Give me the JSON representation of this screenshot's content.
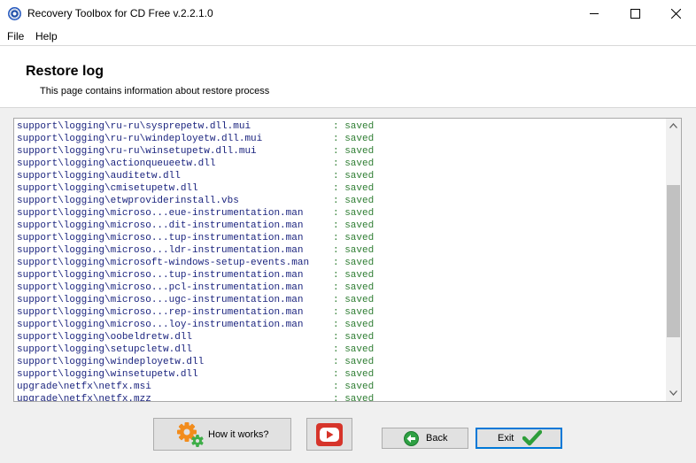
{
  "window": {
    "title": "Recovery Toolbox for CD Free v.2.2.1.0",
    "controls": [
      "minimize-icon",
      "maximize-icon",
      "close-icon"
    ]
  },
  "menu": {
    "file": "File",
    "help": "Help"
  },
  "page": {
    "title": "Restore log",
    "subtitle": "This page contains information about restore process"
  },
  "log": {
    "separator": ":",
    "rows": [
      {
        "path": "support\\logging\\ru-ru\\sysprepetw.dll.mui",
        "status": ": saved"
      },
      {
        "path": "support\\logging\\ru-ru\\windeployetw.dll.mui",
        "status": ": saved"
      },
      {
        "path": "support\\logging\\ru-ru\\winsetupetw.dll.mui",
        "status": ": saved"
      },
      {
        "path": "support\\logging\\actionqueueetw.dll",
        "status": ": saved"
      },
      {
        "path": "support\\logging\\auditetw.dll",
        "status": ": saved"
      },
      {
        "path": "support\\logging\\cmisetupetw.dll",
        "status": ": saved"
      },
      {
        "path": "support\\logging\\etwproviderinstall.vbs",
        "status": ": saved"
      },
      {
        "path": "support\\logging\\microso...eue-instrumentation.man",
        "status": ": saved"
      },
      {
        "path": "support\\logging\\microso...dit-instrumentation.man",
        "status": ": saved"
      },
      {
        "path": "support\\logging\\microso...tup-instrumentation.man",
        "status": ": saved"
      },
      {
        "path": "support\\logging\\microso...ldr-instrumentation.man",
        "status": ": saved"
      },
      {
        "path": "support\\logging\\microsoft-windows-setup-events.man",
        "status": ": saved"
      },
      {
        "path": "support\\logging\\microso...tup-instrumentation.man",
        "status": ": saved"
      },
      {
        "path": "support\\logging\\microso...pcl-instrumentation.man",
        "status": ": saved"
      },
      {
        "path": "support\\logging\\microso...ugc-instrumentation.man",
        "status": ": saved"
      },
      {
        "path": "support\\logging\\microso...rep-instrumentation.man",
        "status": ": saved"
      },
      {
        "path": "support\\logging\\microso...loy-instrumentation.man",
        "status": ": saved"
      },
      {
        "path": "support\\logging\\oobeldretw.dll",
        "status": ": saved"
      },
      {
        "path": "support\\logging\\setupcletw.dll",
        "status": ": saved"
      },
      {
        "path": "support\\logging\\windeployetw.dll",
        "status": ": saved"
      },
      {
        "path": "support\\logging\\winsetupetw.dll",
        "status": ": saved"
      },
      {
        "path": "upgrade\\netfx\\netfx.msi",
        "status": ": saved"
      },
      {
        "path": "upgrade\\netfx\\netfx.mzz",
        "status": ": saved"
      }
    ],
    "path_color": "#1a237e",
    "status_color": "#2e7d32"
  },
  "buttons": {
    "how_it_works": "How it works?",
    "how_icon": "gears-icon",
    "youtube_icon": "youtube-play-icon",
    "back": "Back",
    "back_icon": "green-arrow-left-icon",
    "exit": "Exit",
    "exit_icon": "green-checkmark-icon"
  }
}
